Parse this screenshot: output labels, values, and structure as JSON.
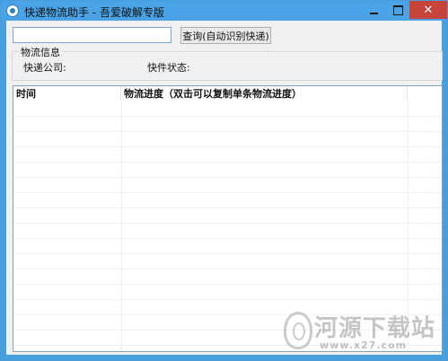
{
  "window": {
    "title": "快递物流助手 - 吾爱破解专版",
    "minimize_symbol": "",
    "maximize_symbol": "",
    "close_symbol": "✕"
  },
  "search": {
    "value": "",
    "placeholder": "",
    "query_button_label": "查询(自动识别快递)"
  },
  "info_group": {
    "title": "物流信息",
    "company_label": "快递公司:",
    "status_label": "快件状态:"
  },
  "list": {
    "columns": [
      "时间",
      "物流进度（双击可以复制单条物流进度）",
      ""
    ],
    "rows": []
  },
  "watermark": {
    "main": "河源下载站",
    "sub": "www.x27.com"
  }
}
